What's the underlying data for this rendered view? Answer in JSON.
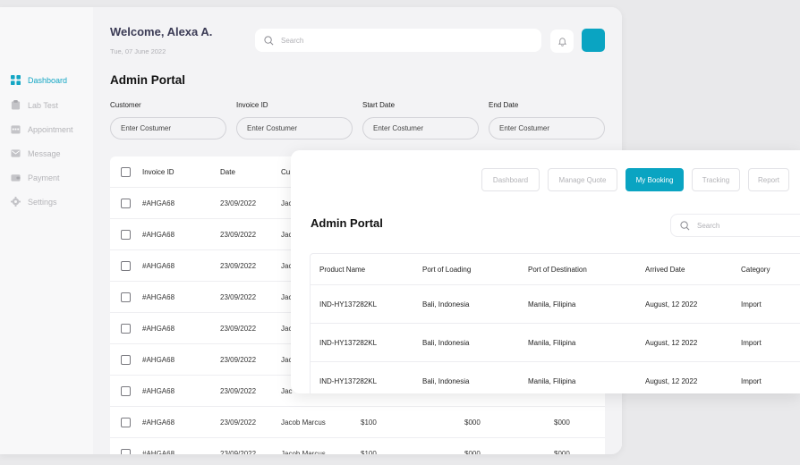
{
  "sidebar": {
    "items": [
      {
        "label": "Dashboard",
        "icon": "grid-icon",
        "active": true
      },
      {
        "label": "Lab Test",
        "icon": "clipboard-icon",
        "active": false
      },
      {
        "label": "Appointment",
        "icon": "calendar-icon",
        "active": false
      },
      {
        "label": "Message",
        "icon": "message-icon",
        "active": false
      },
      {
        "label": "Payment",
        "icon": "wallet-icon",
        "active": false
      },
      {
        "label": "Settings",
        "icon": "gear-icon",
        "active": false
      }
    ]
  },
  "header": {
    "welcome": "Welcome, Alexa A.",
    "date": "Tue, 07 June 2022",
    "search_placeholder": "Search"
  },
  "portal": {
    "title": "Admin Portal",
    "filters": [
      {
        "label": "Customer",
        "placeholder": "Enter Costumer"
      },
      {
        "label": "Invoice ID",
        "placeholder": "Enter Costumer"
      },
      {
        "label": "Start Date",
        "placeholder": "Enter Costumer"
      },
      {
        "label": "End Date",
        "placeholder": "Enter Costumer"
      }
    ],
    "columns": [
      "Invoice ID",
      "Date",
      "Cu"
    ],
    "rows": [
      {
        "invoice": "#AHGA68",
        "date": "23/09/2022",
        "customer": "Jac",
        "amount": "",
        "c5": "",
        "c6": ""
      },
      {
        "invoice": "#AHGA68",
        "date": "23/09/2022",
        "customer": "Jac",
        "amount": "",
        "c5": "",
        "c6": ""
      },
      {
        "invoice": "#AHGA68",
        "date": "23/09/2022",
        "customer": "Jac",
        "amount": "",
        "c5": "",
        "c6": ""
      },
      {
        "invoice": "#AHGA68",
        "date": "23/09/2022",
        "customer": "Jac",
        "amount": "",
        "c5": "",
        "c6": ""
      },
      {
        "invoice": "#AHGA68",
        "date": "23/09/2022",
        "customer": "Jac",
        "amount": "",
        "c5": "",
        "c6": ""
      },
      {
        "invoice": "#AHGA68",
        "date": "23/09/2022",
        "customer": "Jac",
        "amount": "",
        "c5": "",
        "c6": ""
      },
      {
        "invoice": "#AHGA68",
        "date": "23/09/2022",
        "customer": "Jac",
        "amount": "",
        "c5": "",
        "c6": ""
      },
      {
        "invoice": "#AHGA68",
        "date": "23/09/2022",
        "customer": "Jacob Marcus",
        "amount": "$100",
        "c5": "$000",
        "c6": "$000"
      },
      {
        "invoice": "#AHGA68",
        "date": "23/09/2022",
        "customer": "Jacob Marcus",
        "amount": "$100",
        "c5": "$000",
        "c6": "$000"
      }
    ]
  },
  "booking": {
    "nav": [
      {
        "label": "Dashboard",
        "active": false
      },
      {
        "label": "Manage Quote",
        "active": false
      },
      {
        "label": "My Booking",
        "active": true
      },
      {
        "label": "Tracking",
        "active": false
      },
      {
        "label": "Report",
        "active": false
      }
    ],
    "title": "Admin Portal",
    "search_placeholder": "Search",
    "columns": [
      "Product Name",
      "Port of Loading",
      "Port of Destination",
      "Arrived Date",
      "Category"
    ],
    "rows": [
      {
        "product": "IND-HY137282KL",
        "loading": "Bali, Indonesia",
        "destination": "Manila, Filipina",
        "arrived": "August, 12 2022",
        "category": "Import"
      },
      {
        "product": "IND-HY137282KL",
        "loading": "Bali, Indonesia",
        "destination": "Manila, Filipina",
        "arrived": "August, 12 2022",
        "category": "Import"
      },
      {
        "product": "IND-HY137282KL",
        "loading": "Bali, Indonesia",
        "destination": "Manila, Filipina",
        "arrived": "August, 12 2022",
        "category": "Import"
      }
    ]
  },
  "colors": {
    "accent": "#0aa4c2",
    "muted": "#b4b4b8"
  }
}
